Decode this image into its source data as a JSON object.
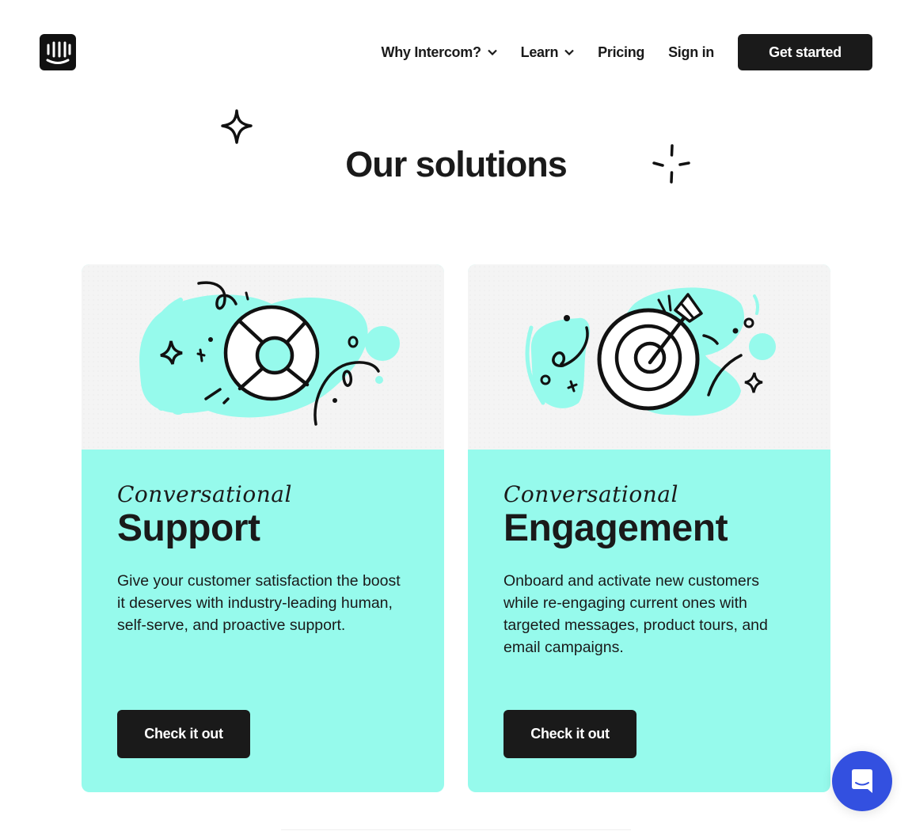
{
  "header": {
    "logo_icon": "intercom-logo-icon",
    "nav": [
      {
        "label": "Why Intercom?",
        "has_dropdown": true
      },
      {
        "label": "Learn",
        "has_dropdown": true
      },
      {
        "label": "Pricing",
        "has_dropdown": false
      },
      {
        "label": "Sign in",
        "has_dropdown": false
      }
    ],
    "cta_label": "Get started"
  },
  "section": {
    "title": "Our solutions",
    "decor_icons": [
      "sparkle-icon",
      "twinkle-icon"
    ]
  },
  "cards": [
    {
      "illustration": "lifebuoy-icon",
      "kicker": "Conversational",
      "heading": "Support",
      "description": "Give your customer satisfaction the boost it deserves with industry-leading human, self-serve, and proactive support.",
      "button_label": "Check it out"
    },
    {
      "illustration": "target-arrow-icon",
      "kicker": "Conversational",
      "heading": "Engagement",
      "description": "Onboard and activate new customers while re-engaging current ones with targeted messages, product tours, and email campaigns.",
      "button_label": "Check it out"
    }
  ],
  "messenger": {
    "icon": "chat-bubble-icon"
  },
  "colors": {
    "accent_cyan": "#96faec",
    "dark": "#1a1a1a",
    "messenger_blue": "#3350e0",
    "illustration_bg": "#f4f4f4"
  }
}
